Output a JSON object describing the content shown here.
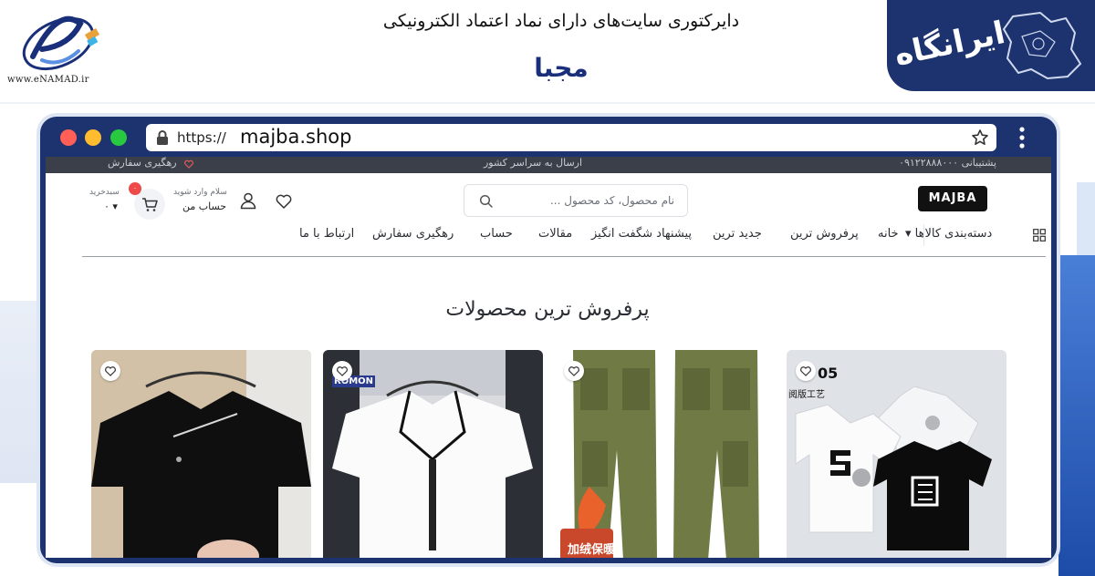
{
  "banner": {
    "enamad_url": "www.eNAMAD.ir",
    "subtitle": "دایرکتوری سایت‌های دارای نماد اعتماد الکترونیکی",
    "title": "مجبا",
    "irangah_logo": "ایرانگاه"
  },
  "browser": {
    "url_prefix": "https://",
    "url_domain": "majba.shop"
  },
  "site": {
    "promo": {
      "left": "رهگیری سفارش",
      "center": "ارسال به سراسر کشور",
      "right": "پشتیبانی ۰۹۱۲۲۸۸۸۰۰۰"
    },
    "logo": "MAJBA",
    "search_placeholder": "نام محصول، کد محصول ...",
    "account_greet": "سلام وارد شوید",
    "account_label": "حساب من",
    "cart_label": "سبدخرید",
    "cart_amount": "۰ ▾",
    "cart_count": "۰",
    "nav": {
      "categories": "دسته‌بندی کالاها ▾",
      "home": "خانه",
      "bestsellers": "پرفروش ترین",
      "newest": "جدید ترین",
      "deals": "پیشنهاد شگفت انگیز",
      "articles": "مقالات",
      "account": "حساب",
      "tracking": "رهگیری سفارش",
      "contact": "ارتباط با ما"
    },
    "section_title": "پرفروش ترین محصولات",
    "products": [
      {
        "image": "graphic-tshirts",
        "label_num": "05",
        "label_cn": "阅版工艺"
      },
      {
        "image": "cargo-pants",
        "badge_cn": "加绒保暖"
      },
      {
        "image": "white-zip-polo",
        "tag": "ROMON"
      },
      {
        "image": "black-tshirt"
      }
    ]
  },
  "colors": {
    "navy": "#1d3370",
    "promo_bar": "#3a3f4a",
    "cart_badge": "#ef4a4a"
  }
}
